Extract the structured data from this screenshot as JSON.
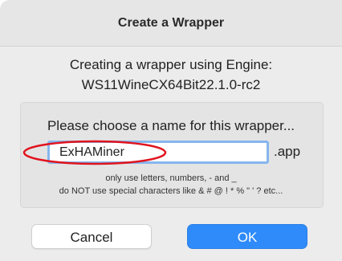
{
  "dialog": {
    "title": "Create a Wrapper",
    "engine_line1": "Creating a wrapper using Engine:",
    "engine_line2": "WS11WineCX64Bit22.1.0-rc2"
  },
  "name_panel": {
    "prompt": "Please choose a name for this wrapper...",
    "input_value": "ExHAMiner",
    "suffix": ".app",
    "hint1": "only use letters, numbers, - and _",
    "hint2": "do NOT use special characters like & # @ ! * % \" ' ? etc..."
  },
  "buttons": {
    "cancel": "Cancel",
    "ok": "OK"
  },
  "colors": {
    "accent": "#2f8bfa",
    "annotation": "#e0141e",
    "focus_ring": "#86b6ee"
  }
}
